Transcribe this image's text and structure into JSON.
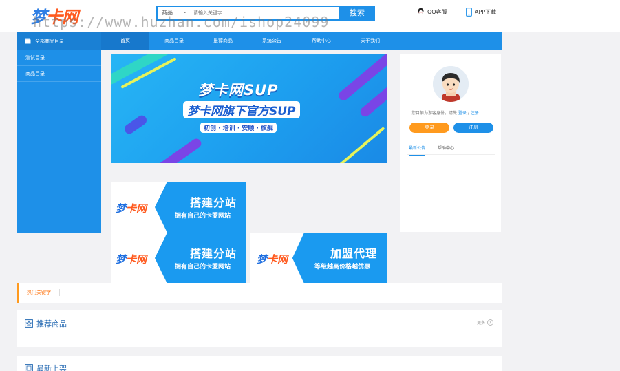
{
  "header": {
    "logo_main": "梦",
    "logo_accent": "卡网",
    "search_scope": "商品",
    "search_placeholder": "请输入关键字",
    "search_button": "搜索",
    "qq_label": "QQ客服",
    "app_label": "APP下载",
    "watermark": "https://www.huzhan.com/ishop24099"
  },
  "nav": {
    "category_label": "全部商品目录",
    "items": [
      "首页",
      "商品目录",
      "推荐商品",
      "系统公告",
      "帮助中心",
      "关于我们"
    ]
  },
  "sidebar": {
    "items": [
      "测试目录",
      "商品目录"
    ]
  },
  "banner": {
    "title": "梦卡网SUP",
    "subtitle": "梦卡网旗下官方SUP",
    "tags": "初创 · 培训 · 安顺 · 旗舰"
  },
  "user": {
    "welcome_prefix": "您目前为游客身份，请先 ",
    "login_link": "登录",
    "separator": " / ",
    "register_link": "注册",
    "login_button": "登录",
    "register_button": "注册",
    "tab_news": "最新公告",
    "tab_help": "帮助中心"
  },
  "promos": [
    {
      "logo_main": "梦",
      "logo_accent": "卡网",
      "title": "搭建分站",
      "sub": "拥有自己的卡盟网站"
    },
    {
      "logo_main": "梦",
      "logo_accent": "卡网",
      "title": "搭建分站",
      "sub": "拥有自己的卡盟网站"
    },
    {
      "logo_main": "梦",
      "logo_accent": "卡网",
      "title": "加盟代理",
      "sub": "等级越高价格越优惠"
    }
  ],
  "hot_keywords_label": "热门关键字",
  "sections": {
    "recommend": {
      "title": "推荐商品",
      "more": "更多"
    },
    "latest": {
      "title": "最新上架"
    }
  },
  "colors": {
    "primary": "#1e90e8",
    "accent": "#ff9a1e",
    "logo_blue": "#2f7fe4",
    "logo_orange": "#ff5a1f"
  }
}
